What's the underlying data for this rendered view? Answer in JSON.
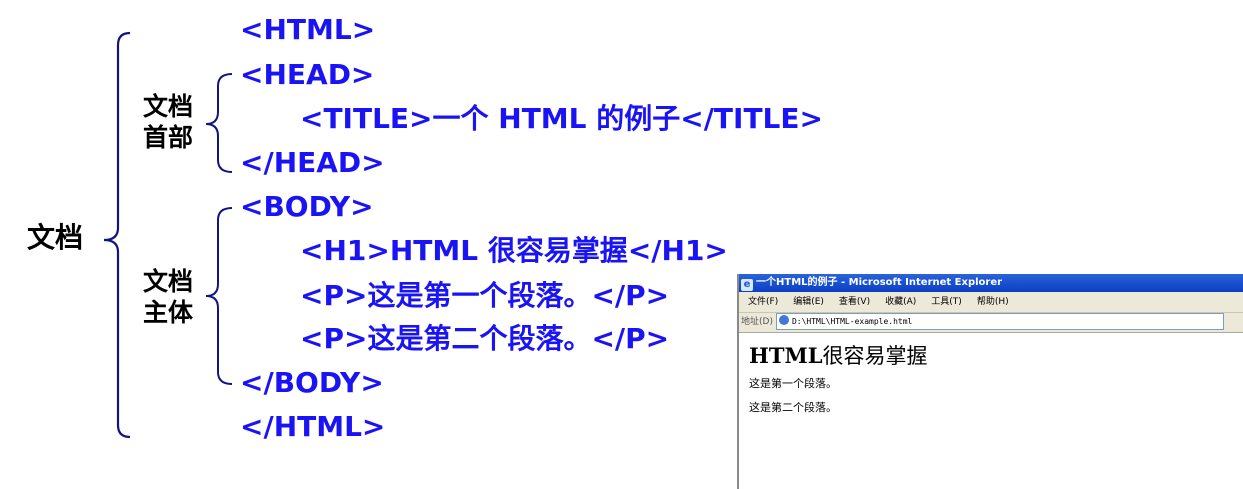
{
  "code_lines": {
    "html_open": "<HTML>",
    "head_open": "<HEAD>",
    "title_line": "<TITLE>一个 HTML 的例子</TITLE>",
    "head_close": "</HEAD>",
    "body_open": "<BODY>",
    "h1_line": "<H1>HTML 很容易掌握</H1>",
    "p1_line": "<P>这是第一个段落。</P>",
    "p2_line": "<P>这是第二个段落。</P>",
    "body_close": "</BODY>",
    "html_close": "</HTML>"
  },
  "labels": {
    "document": "文档",
    "head_line1": "文档",
    "head_line2": "首部",
    "body_line1": "文档",
    "body_line2": "主体"
  },
  "browser": {
    "title": "一个HTML的例子 - Microsoft Internet Explorer",
    "menu": [
      "文件(F)",
      "编辑(E)",
      "查看(V)",
      "收藏(A)",
      "工具(T)",
      "帮助(H)"
    ],
    "address_label": "地址(D)",
    "address": "D:\\HTML\\HTML-example.html",
    "heading_latin": "HTML",
    "heading_cjk": "很容易掌握",
    "paragraphs": [
      "这是第一个段落。",
      "这是第二个段落。"
    ]
  },
  "colors": {
    "code": "#1a14f5",
    "brace": "#141480",
    "titlebar": "#0a3fc4"
  }
}
